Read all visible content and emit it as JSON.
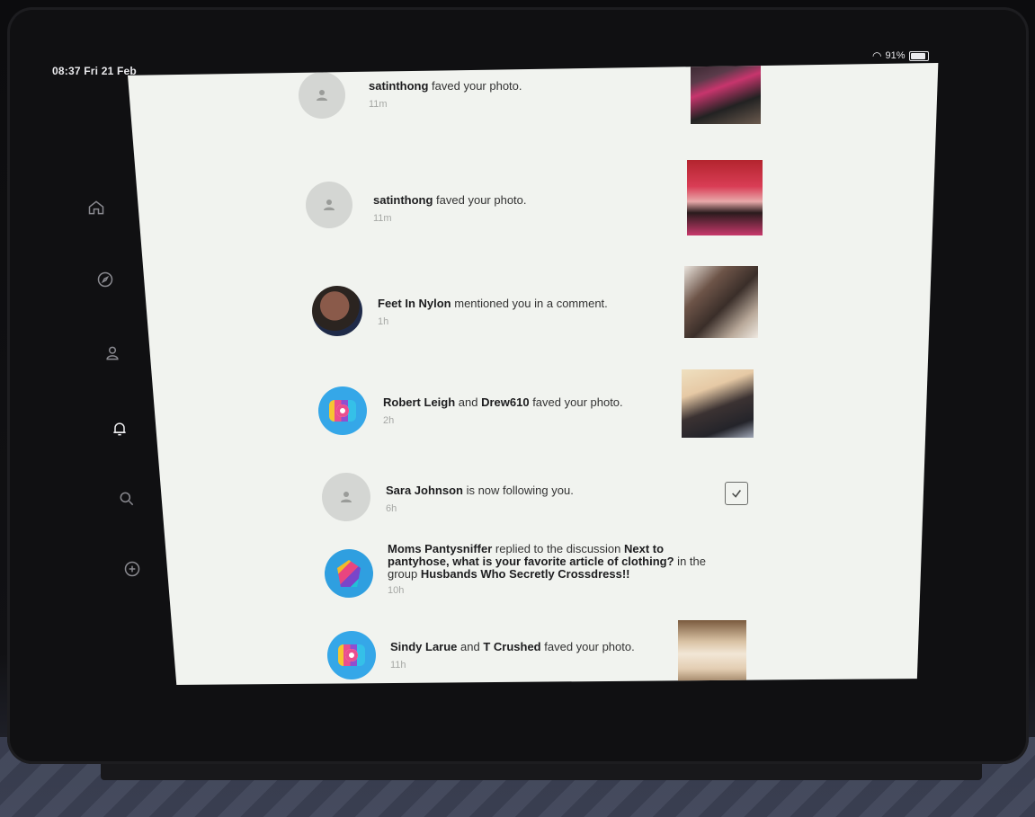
{
  "status_bar": {
    "time": "08:37  Fri 21 Feb",
    "battery": "91%"
  },
  "sidebar": {
    "items": [
      {
        "name": "home",
        "icon": "home-icon",
        "active": false
      },
      {
        "name": "explore",
        "icon": "compass-icon",
        "active": false
      },
      {
        "name": "profile",
        "icon": "person-icon",
        "active": false
      },
      {
        "name": "notifications",
        "icon": "bell-icon",
        "active": true
      },
      {
        "name": "search",
        "icon": "search-icon",
        "active": false
      },
      {
        "name": "upload",
        "icon": "plus-circle-icon",
        "active": false
      }
    ]
  },
  "notifications": [
    {
      "actor": "satinthong",
      "action": " faved your photo.",
      "time": "11m"
    },
    {
      "actor": "satinthong",
      "action": " faved your photo.",
      "time": "11m"
    },
    {
      "actor": "Feet In Nylon",
      "action": " mentioned you in a comment.",
      "time": "1h"
    },
    {
      "actor": "Robert Leigh",
      "conj": " and ",
      "actor2": "Drew610",
      "action": " faved your photo.",
      "time": "2h"
    },
    {
      "actor": "Sara Johnson",
      "action": " is now following you.",
      "time": "6h"
    },
    {
      "actor": "Moms Pantysniffer",
      "action": " replied to the discussion ",
      "topic": "Next to pantyhose, what is your favorite article of clothing?",
      "mid": " in the group ",
      "group": "Husbands Who Secretly Crossdress!!",
      "time": "10h"
    },
    {
      "actor": "Sindy Larue",
      "conj": " and ",
      "actor2": "T Crushed",
      "action": " faved your photo.",
      "time": "11h"
    }
  ],
  "colors": {
    "screen_bg": "#f1f3ef",
    "app_avatar": "#35a7e8",
    "text_dark": "#1d1d1f",
    "time_gray": "#a6a8a5"
  }
}
